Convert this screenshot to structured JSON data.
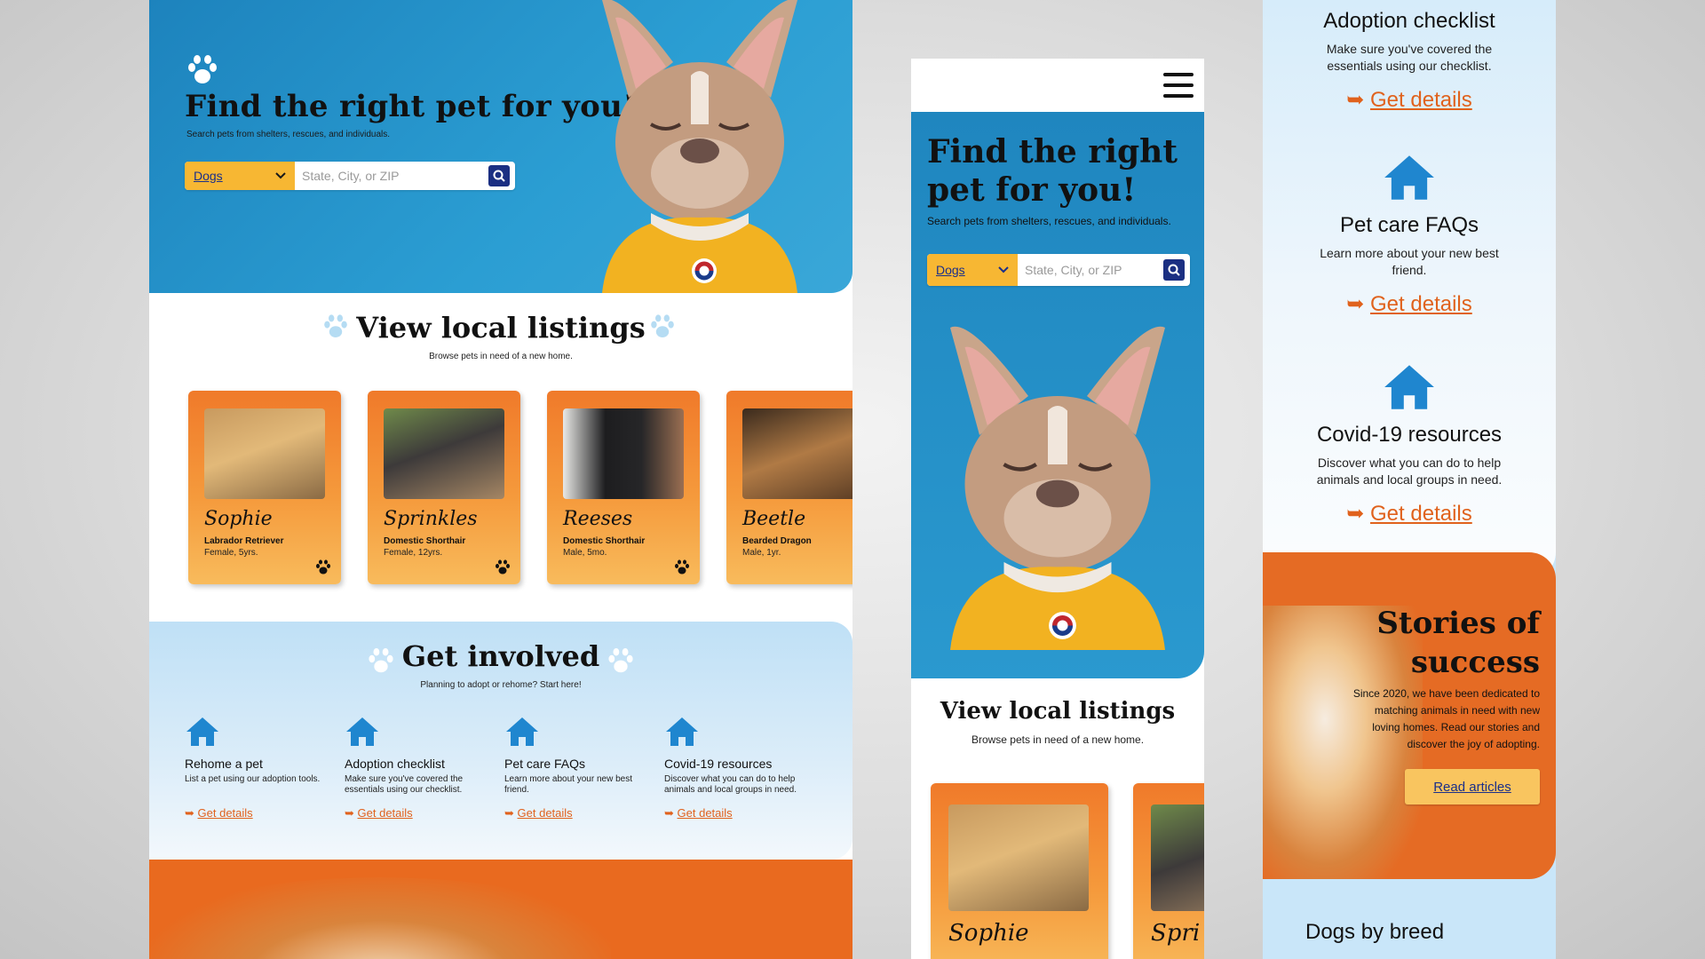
{
  "desktop": {
    "hero": {
      "title": "Find the right pet for you!",
      "subtitle": "Search pets from shelters, rescues, and individuals.",
      "search_select": "Dogs",
      "search_placeholder": "State, City, or ZIP"
    },
    "listings": {
      "title": "View local listings",
      "subtitle": "Browse pets in need of a new home.",
      "cards": [
        {
          "name": "Sophie",
          "breed": "Labrador Retriever",
          "meta": "Female, 5yrs."
        },
        {
          "name": "Sprinkles",
          "breed": "Domestic Shorthair",
          "meta": "Female, 12yrs."
        },
        {
          "name": "Reeses",
          "breed": "Domestic Shorthair",
          "meta": "Male, 5mo."
        },
        {
          "name": "Beetle",
          "breed": "Bearded Dragon",
          "meta": "Male, 1yr."
        }
      ]
    },
    "involved": {
      "title": "Get involved",
      "subtitle": "Planning to adopt or rehome? Start here!",
      "items": [
        {
          "title": "Rehome a pet",
          "desc": "List a pet using our adoption tools.",
          "link": "Get details"
        },
        {
          "title": "Adoption checklist",
          "desc": "Make sure you've covered the essentials using our checklist.",
          "link": "Get details"
        },
        {
          "title": "Pet care FAQs",
          "desc": "Learn more about your new best friend.",
          "link": "Get details"
        },
        {
          "title": "Covid-19 resources",
          "desc": "Discover what you can do to help animals and local groups in need.",
          "link": "Get details"
        }
      ]
    }
  },
  "mobile": {
    "hero": {
      "title": "Find the right pet for you!",
      "subtitle": "Search pets from shelters, rescues, and individuals.",
      "search_select": "Dogs",
      "search_placeholder": "State, City, or ZIP"
    },
    "listings": {
      "title": "View local listings",
      "subtitle": "Browse pets in need of a new home.",
      "cards": [
        {
          "name": "Sophie"
        },
        {
          "name": "Spri"
        }
      ]
    }
  },
  "right": {
    "blocks": [
      {
        "title": "Adoption checklist",
        "desc": "Make sure you've covered the essentials using our checklist.",
        "link": "Get details"
      },
      {
        "title": "Pet care FAQs",
        "desc": "Learn more about your new best friend.",
        "link": "Get details"
      },
      {
        "title": "Covid-19 resources",
        "desc": "Discover what you can do to help animals and local groups in need.",
        "link": "Get details"
      }
    ],
    "stories": {
      "title_line1": "Stories of",
      "title_line2": "success",
      "body": "Since 2020, we have been dedicated to matching animals in need with new loving homes. Read our stories and discover the joy of adopting.",
      "button": "Read articles"
    },
    "breed_title": "Dogs by breed"
  },
  "colors": {
    "hero_blue": "#2b9ed3",
    "accent_orange": "#e0621d",
    "select_yellow": "#f7b733",
    "search_navy": "#1b2f82",
    "icon_blue": "#1f86cf"
  },
  "icons": [
    "paw-icon",
    "search-icon",
    "chevron-down-icon",
    "house-icon",
    "arrow-right-icon",
    "hamburger-menu-icon"
  ]
}
